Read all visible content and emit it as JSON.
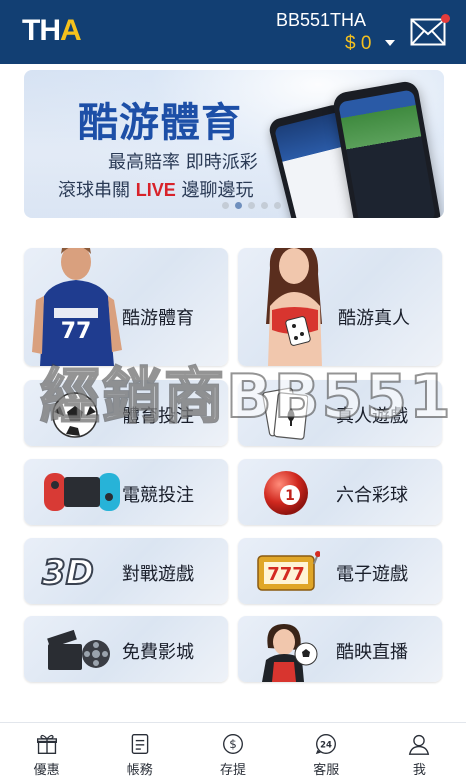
{
  "header": {
    "logo": {
      "t": "T",
      "h": "H",
      "a": "A"
    },
    "username": "BB551THA",
    "balance": "$ 0",
    "colors": {
      "bar": "#123f73",
      "accent": "#f4c01f",
      "notification": "#e43b3b"
    },
    "icons": [
      "caret-down-icon",
      "mail-icon"
    ]
  },
  "banner": {
    "title": "酷游體育",
    "line1": "最高賠率  即時派彩",
    "line2_prefix": "滾球串關 ",
    "line2_live": "LIVE",
    "line2_suffix": " 邊聊邊玩",
    "slides": 5,
    "active_slide": 1
  },
  "tiles": [
    {
      "label": "酷游體育",
      "icon": "basketball-player-icon"
    },
    {
      "label": "酷游真人",
      "icon": "live-dealer-icon"
    },
    {
      "label": "體育投注",
      "icon": "soccer-ball-icon"
    },
    {
      "label": "真人遊戲",
      "icon": "playing-card-icon"
    },
    {
      "label": "電競投注",
      "icon": "game-controller-icon"
    },
    {
      "label": "六合彩球",
      "icon": "lottery-ball-icon"
    },
    {
      "label": "對戰遊戲",
      "icon": "3d-text-icon"
    },
    {
      "label": "電子遊戲",
      "icon": "slot-machine-icon"
    },
    {
      "label": "免費影城",
      "icon": "film-reel-icon"
    },
    {
      "label": "酷映直播",
      "icon": "live-stream-icon"
    }
  ],
  "watermark": "經銷商BB551",
  "nav": [
    {
      "label": "優惠",
      "icon": "gift-icon"
    },
    {
      "label": "帳務",
      "icon": "document-icon"
    },
    {
      "label": "存提",
      "icon": "dollar-icon"
    },
    {
      "label": "客服",
      "icon": "support-24-icon"
    },
    {
      "label": "我",
      "icon": "user-icon"
    }
  ]
}
